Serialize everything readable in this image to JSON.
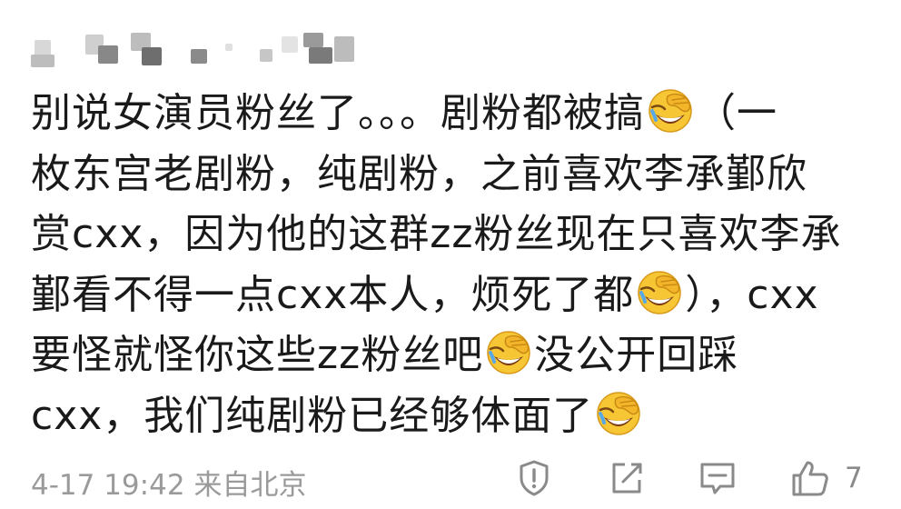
{
  "comment": {
    "lines": [
      [
        "别说女演员粉丝了。。。剧粉都被搞",
        "emoji",
        "（一"
      ],
      [
        "枚东宫老剧粉，纯剧粉，之前喜欢李承鄞欣"
      ],
      [
        "赏cxx，因为他的这群zz粉丝现在只喜欢李承"
      ],
      [
        "鄞看不得一点cxx本人，烦死了都",
        "emoji",
        "），cxx"
      ],
      [
        "要怪就怪你这些zz粉丝吧",
        "emoji",
        "没公开回踩"
      ],
      [
        "cxx，我们纯剧粉已经够体面了",
        "emoji"
      ]
    ],
    "emoji_icon": "facepalm-laughing-emoji"
  },
  "footer": {
    "date_time": "4-17 19:42",
    "location": "来自北京",
    "report_icon": "shield-exclamation-icon",
    "share_icon": "share-edit-icon",
    "reply_icon": "comment-icon",
    "like_icon": "thumbs-up-icon",
    "like_count": "7"
  },
  "colors": {
    "text": "#1a1a1a",
    "meta": "#9a9a9a",
    "icon": "#8a8a8a",
    "emoji_face": "#f7c635"
  }
}
